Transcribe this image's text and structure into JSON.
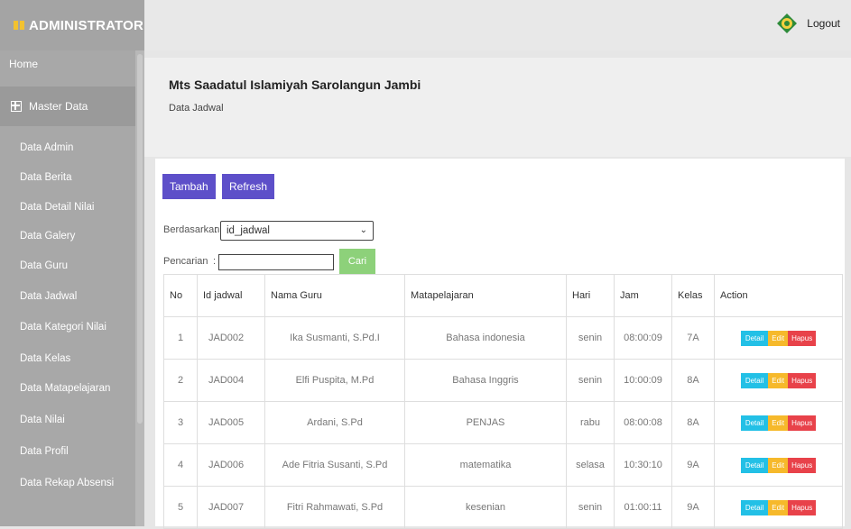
{
  "app": {
    "brand": "ADMINISTRATOR",
    "logout": "Logout"
  },
  "sidebar": {
    "home": "Home",
    "master": "Master Data",
    "items": [
      "Data Admin",
      "Data Berita",
      "Data Detail Nilai",
      "Data Galery",
      "Data Guru",
      "Data Jadwal",
      "Data Kategori Nilai",
      "Data Kelas",
      "Data Matapelajaran",
      "Data Nilai",
      "Data Profil",
      "Data Rekap Absensi"
    ]
  },
  "header": {
    "title": "Mts Saadatul Islamiyah Sarolangun Jambi",
    "subtitle": "Data Jadwal"
  },
  "toolbar": {
    "tambah": "Tambah",
    "refresh": "Refresh"
  },
  "filter": {
    "berdasarkan_label": "Berdasarkan",
    "selected": "id_jadwal",
    "pencarian_label": "Pencarian",
    "cari": "Cari"
  },
  "table": {
    "headers": [
      "No",
      "Id jadwal",
      "Nama Guru",
      "Matapelajaran",
      "Hari",
      "Jam",
      "Kelas",
      "Action"
    ],
    "rows": [
      [
        "1",
        "JAD002",
        "Ika Susmanti, S.Pd.I",
        "Bahasa indonesia",
        "senin",
        "08:00:09",
        "7A"
      ],
      [
        "2",
        "JAD004",
        "Elfi Puspita, M.Pd",
        "Bahasa Inggris",
        "senin",
        "10:00:09",
        "8A"
      ],
      [
        "3",
        "JAD005",
        "Ardani, S.Pd",
        "PENJAS",
        "rabu",
        "08:00:08",
        "8A"
      ],
      [
        "4",
        "JAD006",
        "Ade Fitria Susanti, S.Pd",
        "matematika",
        "selasa",
        "10:30:10",
        "9A"
      ],
      [
        "5",
        "JAD007",
        "Fitri Rahmawati, S.Pd",
        "kesenian",
        "senin",
        "01:00:11",
        "9A"
      ]
    ],
    "actions": {
      "detail": "Detail",
      "edit": "Edit",
      "hapus": "Hapus"
    }
  }
}
